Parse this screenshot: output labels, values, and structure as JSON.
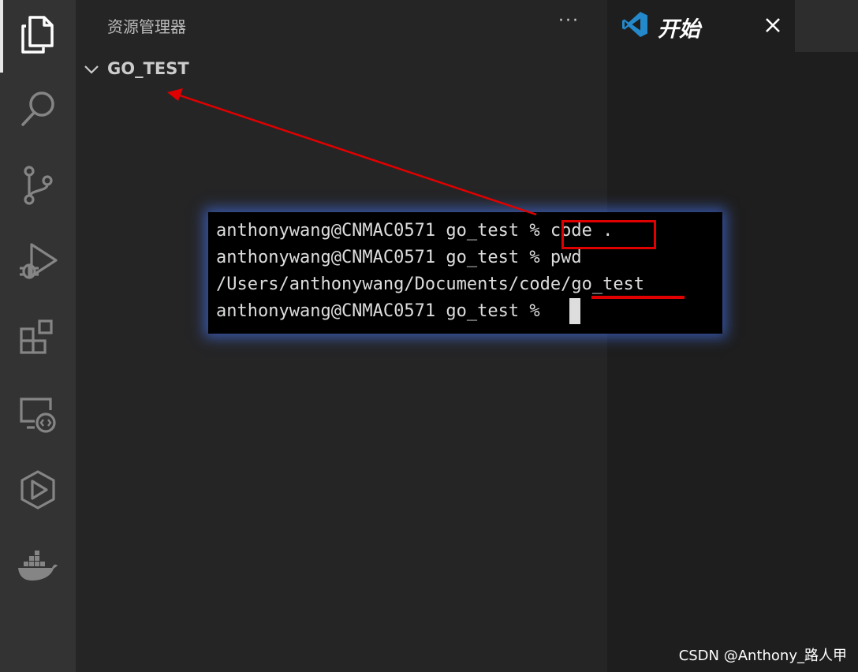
{
  "activity_bar": {
    "items": [
      {
        "name": "explorer",
        "icon": "files-icon",
        "active": true
      },
      {
        "name": "search",
        "icon": "search-icon"
      },
      {
        "name": "source-control",
        "icon": "source-control-icon"
      },
      {
        "name": "run-and-debug",
        "icon": "run-debug-icon"
      },
      {
        "name": "extensions",
        "icon": "extensions-icon"
      },
      {
        "name": "remote-explorer",
        "icon": "remote-explorer-icon"
      },
      {
        "name": "live-share",
        "icon": "live-share-icon"
      },
      {
        "name": "docker",
        "icon": "docker-icon"
      }
    ]
  },
  "sidebar": {
    "title": "资源管理器",
    "more_label": "···",
    "folder": "GO_TEST"
  },
  "editor": {
    "tab_label": "开始",
    "tab_icon": "vscode-logo-icon"
  },
  "terminal": {
    "lines": [
      "anthonywang@CNMAC0571 go_test % code .",
      "anthonywang@CNMAC0571 go_test % pwd",
      "/Users/anthonywang/Documents/code/go_test",
      "anthonywang@CNMAC0571 go_test % "
    ],
    "highlighted_command": "code .",
    "underlined_text": "go_test"
  },
  "annotation": {
    "color": "#e00000"
  },
  "watermark": "CSDN @Anthony_路人甲",
  "colors": {
    "activity_bar": "#333333",
    "sidebar": "#252526",
    "editor": "#1e1e1e",
    "terminal_bg": "#000000",
    "accent_blue": "#2489ca"
  }
}
